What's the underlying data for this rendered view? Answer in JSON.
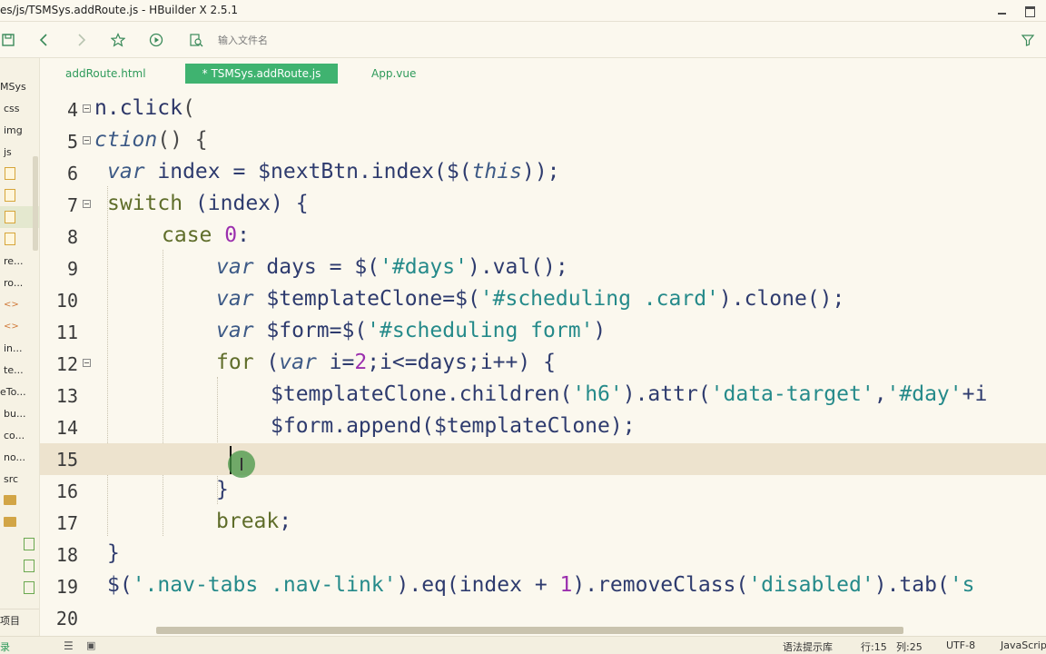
{
  "window": {
    "title": "es/js/TSMSys.addRoute.js - HBuilder X 2.5.1"
  },
  "toolbar": {
    "filename_placeholder": "输入文件名",
    "icons": [
      "save-icon",
      "back-icon",
      "forward-icon",
      "star-icon",
      "run-icon",
      "find-file-icon",
      "filter-icon"
    ]
  },
  "sidebar": {
    "items": [
      {
        "label": "MSys"
      },
      {
        "label": "css"
      },
      {
        "label": "img"
      },
      {
        "label": "js"
      },
      {
        "label": ""
      },
      {
        "label": ""
      },
      {
        "label": ""
      },
      {
        "label": ""
      },
      {
        "label": "re..."
      },
      {
        "label": "ro..."
      },
      {
        "label": ""
      },
      {
        "label": ""
      },
      {
        "label": "in..."
      },
      {
        "label": "te..."
      },
      {
        "label": "eTo..."
      },
      {
        "label": "bu..."
      },
      {
        "label": "co..."
      },
      {
        "label": "no..."
      },
      {
        "label": "src"
      },
      {
        "label": ""
      },
      {
        "label": ""
      },
      {
        "label": ""
      },
      {
        "label": ""
      },
      {
        "label": ""
      }
    ],
    "bottom_label": "项目"
  },
  "tabs": [
    {
      "label": "addRoute.html",
      "active": false
    },
    {
      "label": "* TSMSys.addRoute.js",
      "active": true
    },
    {
      "label": "App.vue",
      "active": false
    }
  ],
  "editor": {
    "current_line": 15,
    "lines": [
      {
        "num": "4",
        "fold": true,
        "text": "n.click("
      },
      {
        "num": "5",
        "fold": true,
        "text": "ction() {"
      },
      {
        "num": "6",
        "fold": false,
        "text": "var index = $nextBtn.index($(this));"
      },
      {
        "num": "7",
        "fold": true,
        "text": "switch (index) {"
      },
      {
        "num": "8",
        "fold": false,
        "text": "case 0:"
      },
      {
        "num": "9",
        "fold": false,
        "text": "var days = $('#days').val();"
      },
      {
        "num": "10",
        "fold": false,
        "text": "var $templateClone=$('#scheduling .card').clone();"
      },
      {
        "num": "11",
        "fold": false,
        "text": "var $form=$('#scheduling form')"
      },
      {
        "num": "12",
        "fold": true,
        "text": "for (var i=2;i<=days;i++) {"
      },
      {
        "num": "13",
        "fold": false,
        "text": "$templateClone.children('h6').attr('data-target','#day'+i"
      },
      {
        "num": "14",
        "fold": false,
        "text": "$form.append($templateClone);"
      },
      {
        "num": "15",
        "fold": false,
        "text": ""
      },
      {
        "num": "16",
        "fold": false,
        "text": "}"
      },
      {
        "num": "17",
        "fold": false,
        "text": "break;"
      },
      {
        "num": "18",
        "fold": false,
        "text": "}"
      },
      {
        "num": "19",
        "fold": false,
        "text": "$('.nav-tabs .nav-link').eq(index + 1).removeClass('disabled').tab('s"
      },
      {
        "num": "20",
        "fold": false,
        "text": ""
      }
    ]
  },
  "statusbar": {
    "left_label": "录",
    "hint": "语法提示库",
    "line": "行:15",
    "column": "列:25",
    "encoding": "UTF-8",
    "language": "JavaScrip"
  },
  "colors": {
    "background": "#fbf8ee",
    "current_line": "#ede3ce",
    "active_tab": "#3fb370",
    "tab_text": "#2e9a5a",
    "keyword": "#3d5a86",
    "string": "#258a8a",
    "number": "#9b2fae"
  }
}
